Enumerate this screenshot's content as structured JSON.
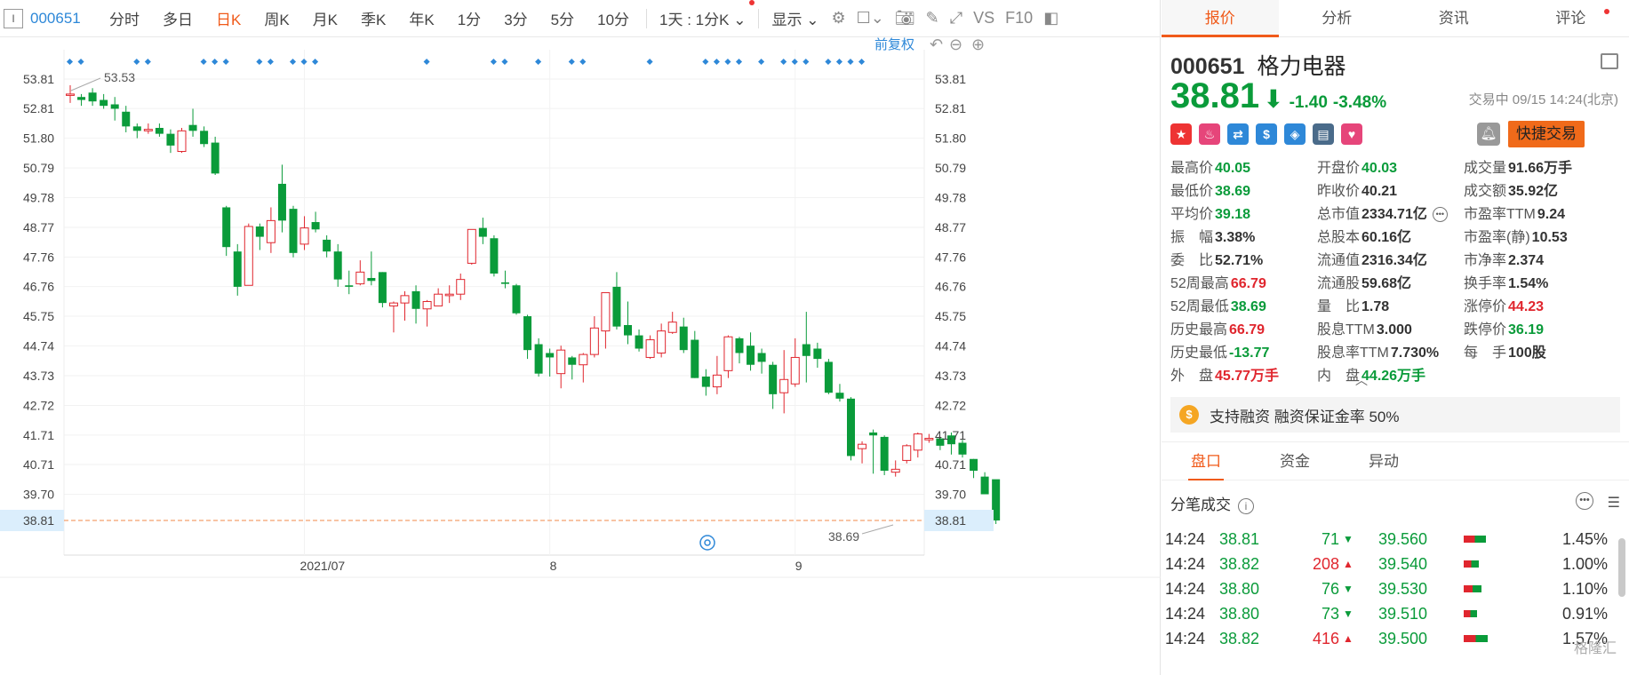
{
  "toolbar": {
    "code": "000651",
    "periods": [
      "分时",
      "多日",
      "日K",
      "周K",
      "月K",
      "季K",
      "年K",
      "1分",
      "3分",
      "5分",
      "10分"
    ],
    "active_period": "日K",
    "interval_select": "1天 : 1分K",
    "display_label": "显示",
    "vs_label": "VS",
    "f10_label": "F10"
  },
  "chart": {
    "adjust_label": "前复权",
    "current_price_label": "38.81",
    "max_label": "53.53",
    "min_label": "38.69",
    "x_ticks": [
      "2021/07",
      "8",
      "9"
    ],
    "colors": {
      "up": "#e0262e",
      "down": "#0a9b3a",
      "marker": "#2e88d8",
      "price_line": "#f08a4a"
    }
  },
  "chart_data": {
    "type": "candlestick",
    "y_ticks": [
      53.81,
      52.81,
      51.8,
      50.79,
      49.78,
      48.77,
      47.76,
      46.76,
      45.75,
      44.74,
      43.73,
      42.72,
      41.71,
      40.71,
      39.7,
      38.81
    ],
    "ylim": [
      38.3,
      54.4
    ],
    "x_labels": [
      "2021/07",
      "8",
      "9"
    ],
    "candles": [
      [
        53.3,
        53.3,
        53.6,
        53.0
      ],
      [
        53.2,
        53.1,
        53.3,
        52.9
      ],
      [
        53.35,
        53.05,
        53.5,
        52.9
      ],
      [
        53.1,
        52.9,
        53.3,
        52.8
      ],
      [
        52.95,
        52.8,
        53.2,
        52.4
      ],
      [
        52.7,
        52.2,
        52.9,
        52.0
      ],
      [
        52.2,
        52.05,
        52.3,
        51.8
      ],
      [
        52.05,
        52.1,
        52.3,
        51.95
      ],
      [
        52.15,
        51.95,
        52.3,
        51.85
      ],
      [
        51.95,
        51.55,
        52.1,
        51.3
      ],
      [
        51.35,
        52.05,
        52.15,
        51.3
      ],
      [
        52.25,
        52.05,
        52.8,
        51.85
      ],
      [
        52.05,
        51.6,
        52.2,
        51.5
      ],
      [
        51.65,
        50.6,
        51.85,
        50.55
      ],
      [
        49.45,
        48.1,
        49.5,
        47.8
      ],
      [
        47.95,
        46.75,
        48.2,
        46.45
      ],
      [
        46.8,
        48.8,
        48.9,
        46.8
      ],
      [
        48.8,
        48.45,
        48.9,
        48.0
      ],
      [
        48.25,
        49.0,
        49.45,
        47.9
      ],
      [
        50.25,
        49.0,
        50.9,
        48.6
      ],
      [
        49.4,
        47.9,
        49.5,
        47.75
      ],
      [
        48.2,
        48.75,
        49.15,
        48.0
      ],
      [
        48.95,
        48.7,
        49.3,
        48.6
      ],
      [
        48.35,
        47.95,
        48.5,
        47.75
      ],
      [
        47.95,
        47.0,
        48.2,
        46.75
      ],
      [
        46.8,
        46.75,
        47.3,
        46.5
      ],
      [
        46.85,
        47.25,
        47.65,
        46.8
      ],
      [
        47.05,
        46.95,
        47.95,
        46.8
      ],
      [
        47.25,
        46.2,
        47.25,
        46.05
      ],
      [
        46.1,
        46.2,
        46.25,
        45.2
      ],
      [
        46.2,
        46.45,
        46.6,
        45.6
      ],
      [
        46.6,
        46.0,
        46.8,
        45.5
      ],
      [
        46.0,
        46.25,
        46.3,
        45.4
      ],
      [
        46.1,
        46.5,
        46.7,
        46.1
      ],
      [
        46.45,
        46.5,
        46.8,
        46.2
      ],
      [
        46.5,
        47.0,
        47.2,
        46.3
      ],
      [
        47.55,
        48.7,
        48.7,
        47.5
      ],
      [
        48.75,
        48.45,
        49.1,
        48.2
      ],
      [
        48.4,
        47.2,
        48.5,
        47.1
      ],
      [
        46.9,
        46.85,
        47.3,
        46.7
      ],
      [
        46.8,
        45.85,
        46.85,
        45.8
      ],
      [
        45.75,
        44.6,
        45.8,
        44.3
      ],
      [
        44.8,
        43.8,
        45.0,
        43.7
      ],
      [
        44.5,
        44.35,
        44.65,
        43.7
      ],
      [
        43.8,
        44.6,
        44.75,
        43.3
      ],
      [
        44.35,
        44.1,
        44.4,
        43.6
      ],
      [
        44.1,
        44.45,
        44.5,
        43.5
      ],
      [
        44.45,
        45.35,
        45.75,
        44.35
      ],
      [
        45.25,
        46.55,
        46.55,
        44.65
      ],
      [
        46.75,
        45.4,
        47.25,
        45.3
      ],
      [
        45.45,
        45.1,
        46.25,
        44.8
      ],
      [
        45.1,
        44.65,
        45.3,
        44.55
      ],
      [
        44.35,
        44.95,
        45.1,
        44.3
      ],
      [
        44.5,
        45.25,
        45.5,
        44.35
      ],
      [
        45.2,
        45.55,
        45.9,
        45.15
      ],
      [
        45.4,
        44.6,
        45.7,
        44.5
      ],
      [
        44.95,
        43.65,
        45.25,
        43.65
      ],
      [
        43.7,
        43.35,
        43.95,
        43.05
      ],
      [
        43.35,
        43.75,
        44.4,
        43.1
      ],
      [
        43.9,
        45.05,
        45.1,
        43.65
      ],
      [
        45.0,
        44.5,
        45.05,
        44.15
      ],
      [
        44.75,
        44.1,
        45.2,
        43.9
      ],
      [
        44.5,
        44.2,
        44.65,
        43.8
      ],
      [
        44.1,
        43.1,
        44.2,
        42.6
      ],
      [
        43.15,
        43.6,
        44.6,
        42.45
      ],
      [
        43.45,
        44.35,
        45.0,
        43.35
      ],
      [
        44.8,
        44.4,
        45.9,
        43.5
      ],
      [
        44.65,
        44.3,
        44.85,
        44.0
      ],
      [
        44.2,
        43.15,
        44.3,
        43.1
      ],
      [
        43.15,
        42.95,
        43.45,
        42.85
      ],
      [
        42.95,
        41.0,
        43.0,
        40.85
      ],
      [
        41.25,
        41.4,
        41.5,
        40.75
      ],
      [
        41.8,
        41.7,
        41.9,
        40.4
      ],
      [
        41.65,
        40.5,
        41.7,
        40.35
      ],
      [
        40.45,
        40.55,
        40.85,
        40.3
      ],
      [
        40.85,
        41.35,
        41.4,
        40.75
      ],
      [
        41.2,
        41.75,
        41.8,
        40.95
      ],
      [
        41.55,
        41.6,
        41.75,
        41.45
      ],
      [
        41.6,
        41.35,
        41.65,
        41.2
      ],
      [
        41.7,
        41.4,
        41.8,
        41.05
      ],
      [
        41.45,
        41.05,
        41.55,
        40.95
      ],
      [
        40.9,
        40.5,
        40.9,
        40.25
      ],
      [
        40.3,
        39.7,
        40.45,
        39.7
      ],
      [
        40.21,
        38.81,
        40.05,
        38.69
      ]
    ]
  },
  "quote_tabs": [
    "报价",
    "分析",
    "资讯",
    "评论"
  ],
  "stock": {
    "code": "000651",
    "name": "格力电器",
    "price": "38.81",
    "arrow": "⬇",
    "change": "-1.40",
    "change_pct": "-3.48%",
    "status": "交易中 09/15 14:24(北京)",
    "fast_trade": "快捷交易"
  },
  "stats": [
    [
      {
        "label": "最高价",
        "value": "40.05",
        "color": "grn"
      },
      {
        "label": "开盘价",
        "value": "40.03",
        "color": "grn"
      },
      {
        "label": "成交量",
        "value": "91.66万手",
        "color": ""
      }
    ],
    [
      {
        "label": "最低价",
        "value": "38.69",
        "color": "grn"
      },
      {
        "label": "昨收价",
        "value": "40.21",
        "color": ""
      },
      {
        "label": "成交额",
        "value": "35.92亿",
        "color": ""
      }
    ],
    [
      {
        "label": "平均价",
        "value": "39.18",
        "color": "grn"
      },
      {
        "label": "总市值",
        "value": "2334.71亿",
        "color": ""
      },
      {
        "label": "市盈率TTM",
        "value": "9.24",
        "color": ""
      }
    ],
    [
      {
        "label": "振　幅",
        "value": "3.38%",
        "color": ""
      },
      {
        "label": "总股本",
        "value": "60.16亿",
        "color": ""
      },
      {
        "label": "市盈率(静)",
        "value": "10.53",
        "color": ""
      }
    ],
    [
      {
        "label": "委　比",
        "value": "52.71%",
        "color": ""
      },
      {
        "label": "流通值",
        "value": "2316.34亿",
        "color": ""
      },
      {
        "label": "市净率",
        "value": "2.374",
        "color": ""
      }
    ],
    [
      {
        "label": "52周最高",
        "value": "66.79",
        "color": "red"
      },
      {
        "label": "流通股",
        "value": "59.68亿",
        "color": ""
      },
      {
        "label": "换手率",
        "value": "1.54%",
        "color": ""
      }
    ],
    [
      {
        "label": "52周最低",
        "value": "38.69",
        "color": "grn"
      },
      {
        "label": "量　比",
        "value": "1.78",
        "color": ""
      },
      {
        "label": "涨停价",
        "value": "44.23",
        "color": "red"
      }
    ],
    [
      {
        "label": "历史最高",
        "value": "66.79",
        "color": "red"
      },
      {
        "label": "股息TTM",
        "value": "3.000",
        "color": ""
      },
      {
        "label": "跌停价",
        "value": "36.19",
        "color": "grn"
      }
    ],
    [
      {
        "label": "历史最低",
        "value": "-13.77",
        "color": "grn"
      },
      {
        "label": "股息率TTM",
        "value": "7.730%",
        "color": ""
      },
      {
        "label": "每　手",
        "value": "100股",
        "color": ""
      }
    ],
    [
      {
        "label": "外　盘",
        "value": "45.77万手",
        "color": "red"
      },
      {
        "label": "内　盘",
        "value": "44.26万手",
        "color": "grn"
      },
      {
        "label": "",
        "value": "",
        "color": ""
      }
    ]
  ],
  "margin_bar": "支持融资 融资保证金率 50%",
  "subtabs": [
    "盘口",
    "资金",
    "异动"
  ],
  "trades_title": "分笔成交",
  "trades": [
    {
      "time": "14:24",
      "price": "38.81",
      "vol": "71",
      "dir": "down",
      "avg": "39.560",
      "pct": "1.45%",
      "bar": 0.9
    },
    {
      "time": "14:24",
      "price": "38.82",
      "vol": "208",
      "dir": "up",
      "avg": "39.540",
      "pct": "1.00%",
      "bar": 0.6
    },
    {
      "time": "14:24",
      "price": "38.80",
      "vol": "76",
      "dir": "down",
      "avg": "39.530",
      "pct": "1.10%",
      "bar": 0.7
    },
    {
      "time": "14:24",
      "price": "38.80",
      "vol": "73",
      "dir": "down",
      "avg": "39.510",
      "pct": "0.91%",
      "bar": 0.55
    },
    {
      "time": "14:24",
      "price": "38.82",
      "vol": "416",
      "dir": "up",
      "avg": "39.500",
      "pct": "1.57%",
      "bar": 0.95
    }
  ],
  "watermark": "格隆汇"
}
